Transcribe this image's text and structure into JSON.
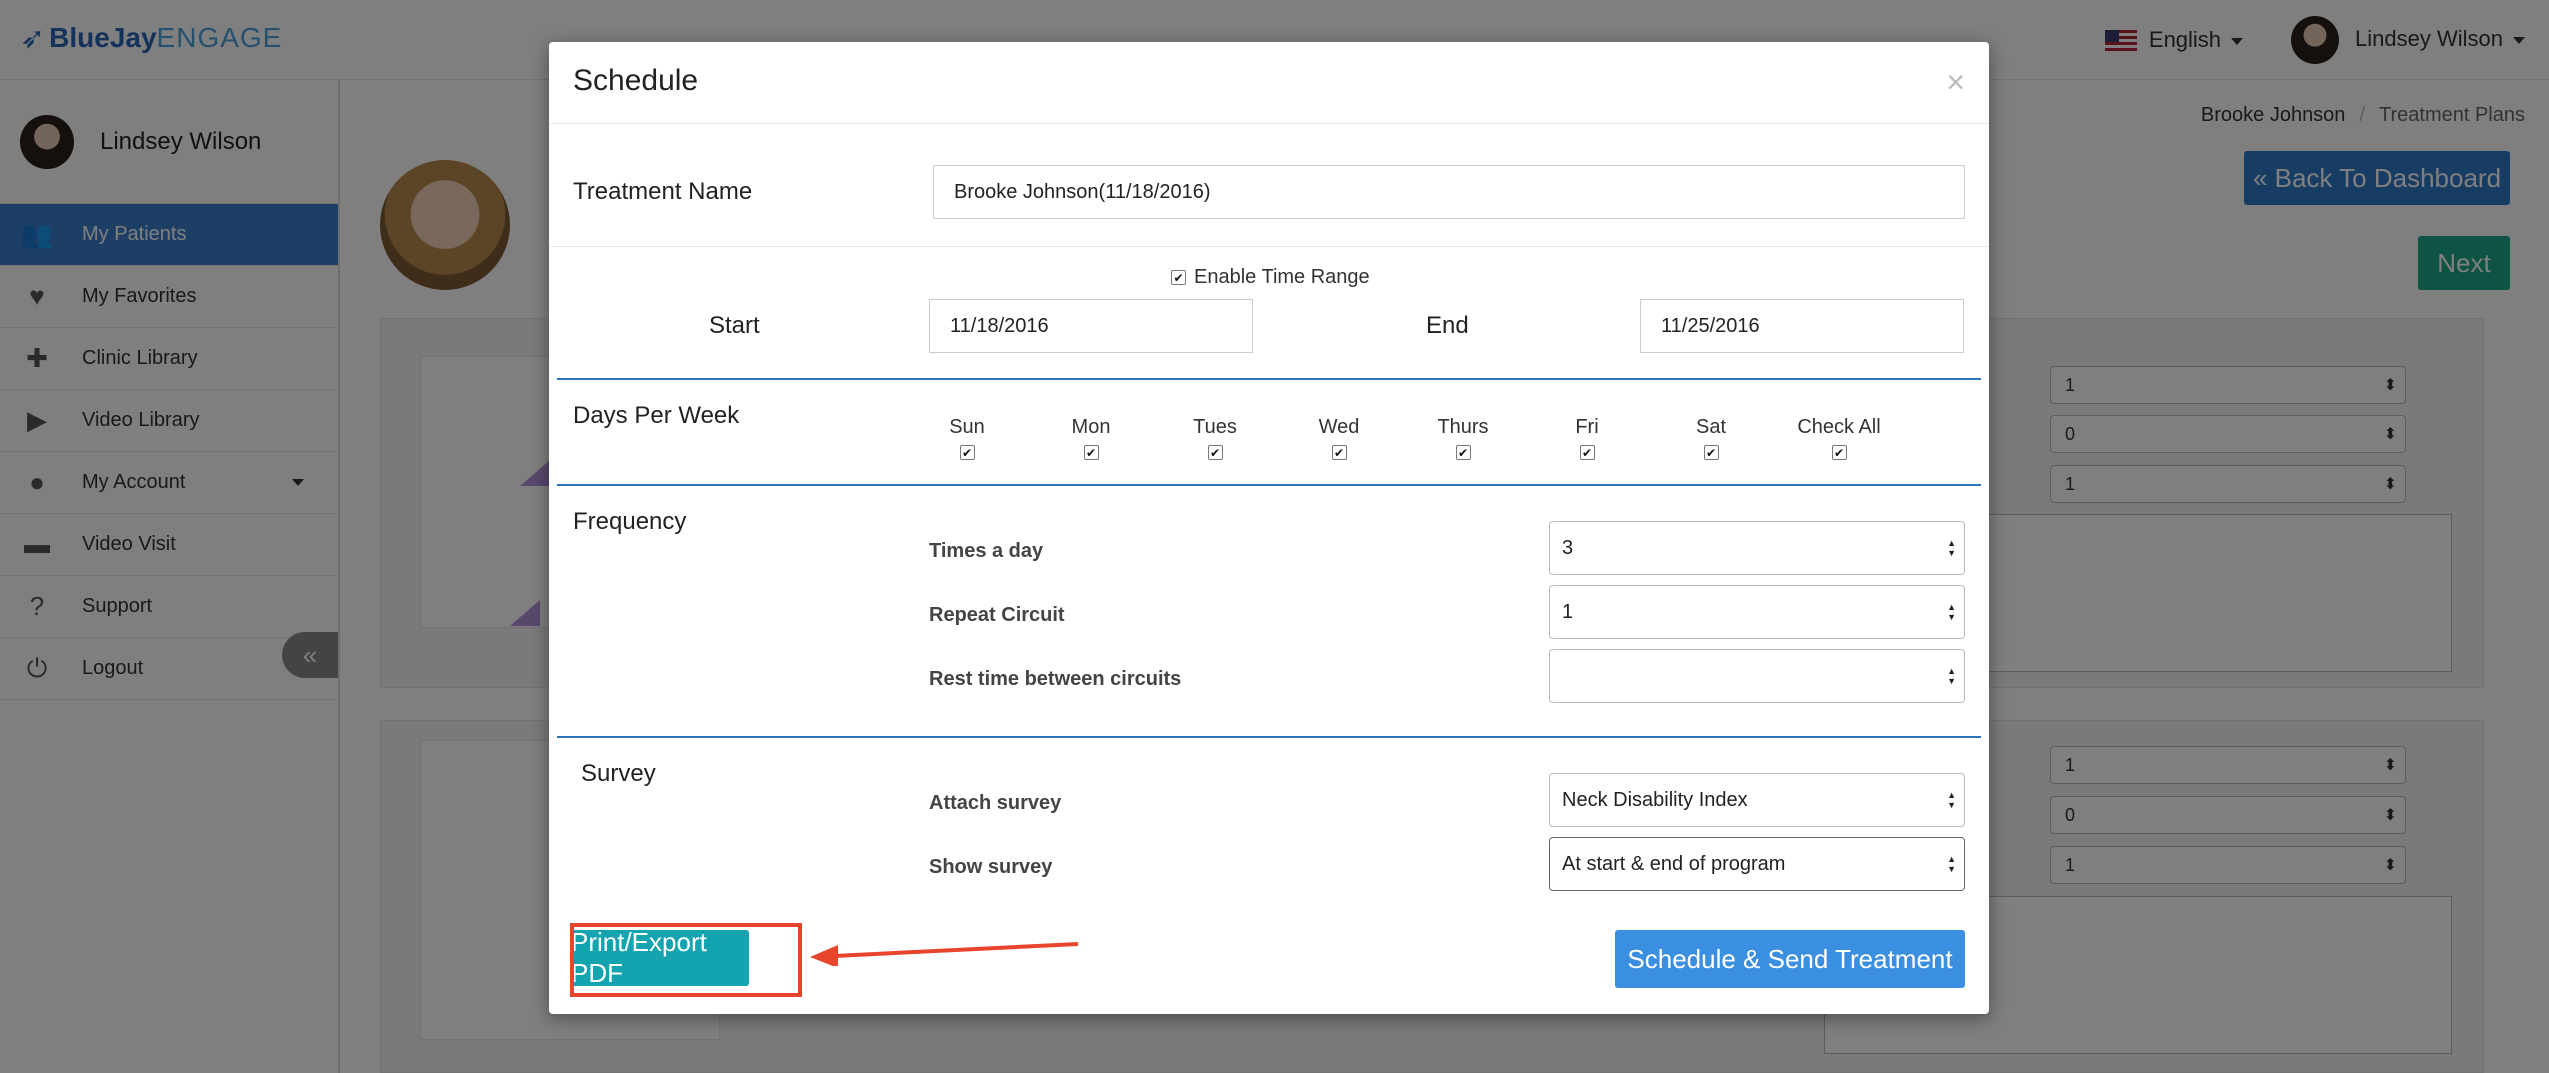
{
  "app": {
    "brand_bold": "BlueJay",
    "brand_light": "ENGAGE"
  },
  "topnav": {
    "language": "English",
    "user": "Lindsey Wilson"
  },
  "sidebar": {
    "user": "Lindsey Wilson",
    "items": [
      {
        "label": "My Patients",
        "icon": "patients-icon"
      },
      {
        "label": "My Favorites",
        "icon": "heart-icon"
      },
      {
        "label": "Clinic Library",
        "icon": "clinic-icon"
      },
      {
        "label": "Video Library",
        "icon": "video-icon"
      },
      {
        "label": "My Account",
        "icon": "account-icon"
      },
      {
        "label": "Video Visit",
        "icon": "calendar-icon"
      },
      {
        "label": "Support",
        "icon": "help-icon"
      },
      {
        "label": "Logout",
        "icon": "power-icon"
      }
    ],
    "collapse": "«"
  },
  "page": {
    "breadcrumb": {
      "patient": "Brooke Johnson",
      "sep": "/",
      "current": "Treatment Plans"
    },
    "back_button": "« Back To Dashboard",
    "next_button": "Next",
    "bg_values": [
      "1",
      "0",
      "1",
      "1",
      "0",
      "1"
    ]
  },
  "modal": {
    "title": "Schedule",
    "close": "×",
    "treatment_name_label": "Treatment Name",
    "treatment_name_value": "Brooke Johnson(11/18/2016)",
    "enable_time_range_label": "Enable Time Range",
    "enable_time_range_checked": true,
    "start_label": "Start",
    "start_value": "11/18/2016",
    "end_label": "End",
    "end_value": "11/25/2016",
    "days_label": "Days Per Week",
    "days": [
      "Sun",
      "Mon",
      "Tues",
      "Wed",
      "Thurs",
      "Fri",
      "Sat",
      "Check All"
    ],
    "frequency_label": "Frequency",
    "times_a_day_label": "Times a day",
    "times_a_day_value": "3",
    "repeat_circuit_label": "Repeat Circuit",
    "repeat_circuit_value": "1",
    "rest_time_label": "Rest time between circuits",
    "rest_time_value": "",
    "survey_label": "Survey",
    "attach_survey_label": "Attach survey",
    "attach_survey_value": "Neck Disability Index",
    "show_survey_label": "Show survey",
    "show_survey_value": "At start & end of program",
    "print_button": "Print/Export PDF",
    "send_button": "Schedule & Send Treatment",
    "checkmark": "✔",
    "select_arrows_up": "▲",
    "select_arrows_down": "▼"
  },
  "colors": {
    "highlight": "#e8452d",
    "primary": "#3a8fe0",
    "teal": "#14a4b0"
  }
}
